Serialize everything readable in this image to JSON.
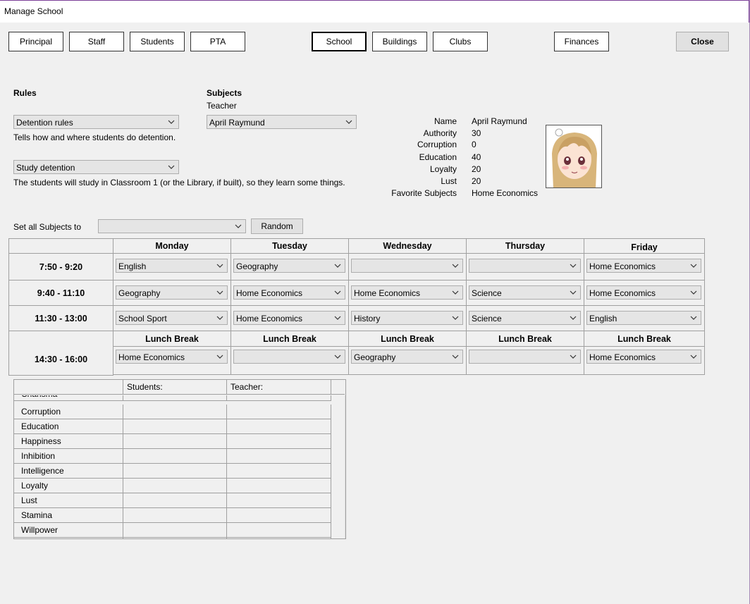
{
  "window": {
    "title": "Manage School"
  },
  "tabs": [
    {
      "label": "Principal"
    },
    {
      "label": "Staff"
    },
    {
      "label": "Students"
    },
    {
      "label": "PTA"
    },
    {
      "label": "School"
    },
    {
      "label": "Buildings"
    },
    {
      "label": "Clubs"
    },
    {
      "label": "Finances"
    }
  ],
  "active_tab": "School",
  "close_label": "Close",
  "rules": {
    "heading": "Rules",
    "detention_rules": "Detention rules",
    "detention_desc": "Tells how and where students do detention.",
    "study_detention": "Study detention",
    "study_desc": "The students will study in Classroom 1 (or the Library, if built), so they learn some things."
  },
  "subjects": {
    "heading": "Subjects",
    "teacher_label": "Teacher",
    "teacher_value": "April Raymund"
  },
  "teacher_info": {
    "labels": [
      "Name",
      "Authority",
      "Corruption",
      "Education",
      "Loyalty",
      "Lust",
      "Favorite Subjects"
    ],
    "values": [
      "April Raymund",
      "30",
      "0",
      "40",
      "20",
      "20",
      "Home Economics"
    ]
  },
  "set_all": {
    "label": "Set all Subjects to",
    "value": "",
    "random_label": "Random"
  },
  "schedule": {
    "days": [
      "Monday",
      "Tuesday",
      "Wednesday",
      "Thursday",
      "Friday"
    ],
    "times": [
      "7:50 - 9:20",
      "9:40 - 11:10",
      "11:30 - 13:00",
      "14:30 - 16:00"
    ],
    "lunch_label": "Lunch Break",
    "slots": [
      [
        "English",
        "Geography",
        "",
        "",
        "Home Economics"
      ],
      [
        "Geography",
        "Home Economics",
        "Home Economics",
        "Science",
        "Home Economics"
      ],
      [
        "School Sport",
        "Home Economics",
        "History",
        "Science",
        "English"
      ],
      [
        "Home Economics",
        "",
        "Geography",
        "",
        "Home Economics"
      ]
    ]
  },
  "stats_table": {
    "headers": [
      "",
      "Students:",
      "Teacher:"
    ],
    "rows": [
      "Charisma",
      "Corruption",
      "Education",
      "Happiness",
      "Inhibition",
      "Intelligence",
      "Loyalty",
      "Lust",
      "Stamina",
      "Willpower"
    ]
  },
  "icons": {
    "arrow": "chevron-down-icon",
    "scroll_up": "chevron-up-icon",
    "scroll_down": "chevron-down-icon"
  }
}
